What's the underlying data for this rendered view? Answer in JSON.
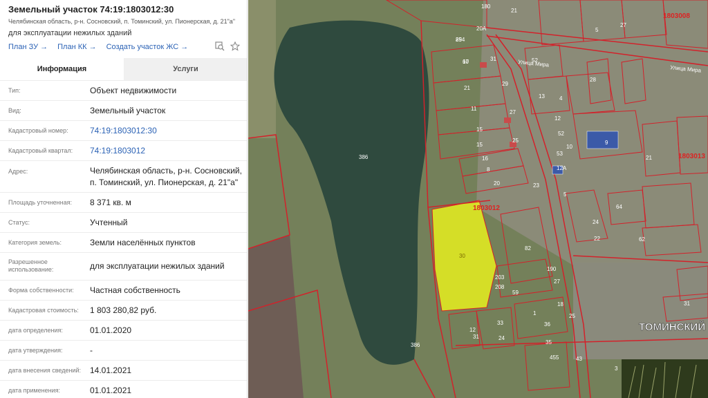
{
  "header": {
    "title": "Земельный участок 74:19:1803012:30",
    "address": "Челябинская область, р-н. Сосновский, п. Томинский, ул. Пионерская, д. 21\"а\"",
    "usage": "для эксплуатации нежилых зданий",
    "links": [
      "План ЗУ →",
      "План КК →",
      "Создать участок ЖС →"
    ]
  },
  "tabs": {
    "info": "Информация",
    "services": "Услуги"
  },
  "rows": [
    {
      "label": "Тип:",
      "value": "Объект недвижимости"
    },
    {
      "label": "Вид:",
      "value": "Земельный участок"
    },
    {
      "label": "Кадастровый номер:",
      "value": "74:19:1803012:30"
    },
    {
      "label": "Кадастровый квартал:",
      "value": "74:19:1803012"
    },
    {
      "label": "Адрес:",
      "value": "Челябинская область, р-н. Сосновский, п. Томинский, ул. Пионерская, д. 21\"а\""
    },
    {
      "label": "Площадь уточненная:",
      "value": "8 371 кв. м"
    },
    {
      "label": "Статус:",
      "value": "Учтенный"
    },
    {
      "label": "Категория земель:",
      "value": "Земли населённых пунктов"
    },
    {
      "label": "Разрешенное использование:",
      "value": "для эксплуатации нежилых зданий"
    },
    {
      "label": "Форма собственности:",
      "value": "Частная собственность"
    },
    {
      "label": "Кадастровая стоимость:",
      "value": "1 803 280,82 руб."
    },
    {
      "label": "дата определения:",
      "value": "01.01.2020"
    },
    {
      "label": "дата утверждения:",
      "value": "-"
    },
    {
      "label": "дата внесения сведений:",
      "value": "14.01.2021"
    },
    {
      "label": "дата применения:",
      "value": "01.01.2021"
    }
  ],
  "map": {
    "quarter_top": "1803008",
    "quarter_right": "1803013",
    "quarter_main": "1803012",
    "street_mira_1": "Улица Мира",
    "street_mira_2": "Улица Мира",
    "settlement": "ТОМИНСКИЙ",
    "parcel_big": "386",
    "parcel_big_2": "386",
    "parcel_selected": "30",
    "plot_labels": [
      "854",
      "60",
      "21",
      "11",
      "15",
      "15",
      "16",
      "8",
      "20",
      "31",
      "29",
      "25",
      "27",
      "23",
      "13",
      "12",
      "10",
      "52",
      "4",
      "53",
      "9",
      "12А",
      "5",
      "24",
      "22",
      "64",
      "62",
      "82",
      "190",
      "203",
      "208",
      "59",
      "18",
      "1",
      "36",
      "31",
      "24",
      "31",
      "3",
      "455",
      "43",
      "5",
      "28",
      "27",
      "21",
      "52",
      "21",
      "20А",
      "180",
      "12",
      "33",
      "35",
      "25",
      "27",
      "29",
      "17"
    ],
    "colors": {
      "selected": "#e6ef1e",
      "boundary": "#d3212a",
      "water": "#2f4a3e"
    }
  }
}
